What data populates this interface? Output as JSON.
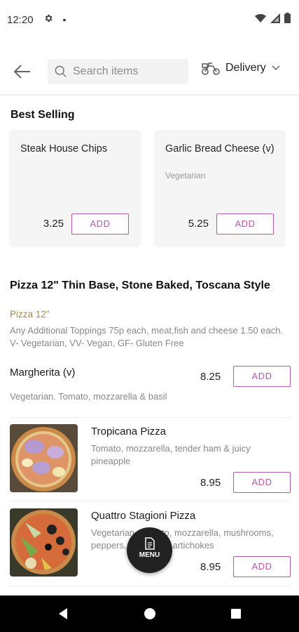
{
  "status_bar": {
    "time": "12:20",
    "dot": "•"
  },
  "header": {
    "search_placeholder": "Search items",
    "delivery_label": "Delivery"
  },
  "best_selling": {
    "title": "Best Selling",
    "items": [
      {
        "name": "Steak House Chips",
        "tag": "",
        "price": "3.25",
        "add_label": "ADD"
      },
      {
        "name": "Garlic Bread Cheese (v)",
        "tag": "Vegetarian",
        "price": "5.25",
        "add_label": "ADD"
      }
    ]
  },
  "category": {
    "title": "Pizza 12\" Thin Base, Stone Baked, Toscana Style",
    "subtitle": "Pizza 12\"",
    "description": "Any Additional Toppings 75p each, meat,fish and cheese 1.50 each. V- Vegetarian, VV- Vegan, GF- Gluten Free"
  },
  "items": [
    {
      "name": "Margherita (v)",
      "desc": "Vegetarian. Tomato, mozzarella & basil",
      "price": "8.25",
      "add_label": "ADD"
    },
    {
      "name": "Tropicana Pizza",
      "desc": "Tomato, mozzarella, tender ham & juicy pineapple",
      "price": "8.95",
      "add_label": "ADD"
    },
    {
      "name": "Quattro Stagioni Pizza",
      "desc": "Vegetarian. Tomato, mozzarella, mushrooms, peppers, olives and artichokes",
      "price": "8.95",
      "add_label": "ADD"
    }
  ],
  "fab": {
    "label": "MENU"
  },
  "colors": {
    "accent": "#b05aa8",
    "subtitle": "#a38a55"
  }
}
